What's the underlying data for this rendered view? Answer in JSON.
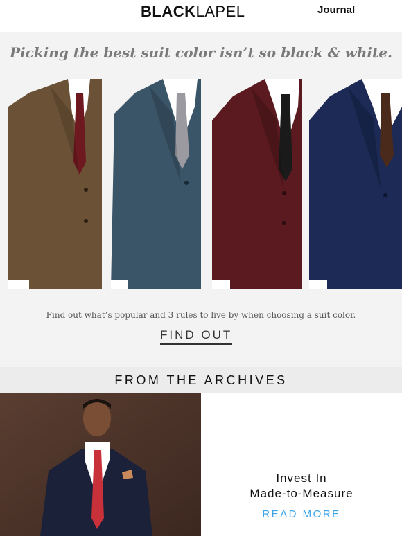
{
  "header": {
    "logo_bold": "BLACK",
    "logo_light": "LAPEL",
    "journal_label": "Journal"
  },
  "hero": {
    "title": "Picking the best suit color isn’t so black & white.",
    "caption": "Find out what’s popular and 3 rules to live by when choosing a suit color.",
    "cta_label": "FIND OUT",
    "suits": [
      {
        "jacket": "#6b5236",
        "tie": "#6e1820"
      },
      {
        "jacket": "#3a5468",
        "tie": "#9a9aa0"
      },
      {
        "jacket": "#5a1a1f",
        "tie": "#1a1a1a"
      },
      {
        "jacket": "#1c2a55",
        "tie": "#4a2a1a"
      }
    ]
  },
  "archives": {
    "title": "FROM THE ARCHIVES"
  },
  "article": {
    "title_line1": "Invest In",
    "title_line2": "Made-to-Measure",
    "cta_label": "READ MORE",
    "jacket_color": "#1b2138",
    "tie_color": "#c8303a",
    "background_color": "#4a3128"
  }
}
